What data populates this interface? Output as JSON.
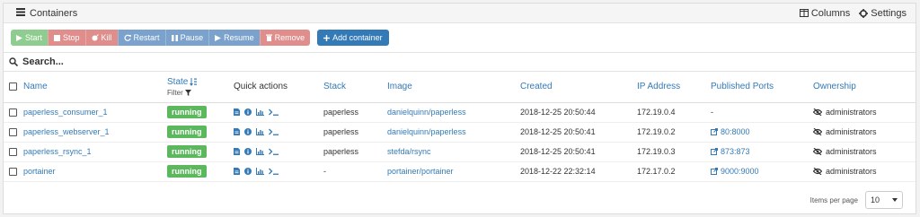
{
  "header": {
    "title": "Containers",
    "columns_label": "Columns",
    "settings_label": "Settings"
  },
  "toolbar": {
    "start": "Start",
    "stop": "Stop",
    "kill": "Kill",
    "restart": "Restart",
    "pause": "Pause",
    "resume": "Resume",
    "remove": "Remove",
    "add": "Add container"
  },
  "search": {
    "placeholder": "Search..."
  },
  "table": {
    "headers": {
      "name": "Name",
      "state": "State",
      "filter": "Filter",
      "quick_actions": "Quick actions",
      "stack": "Stack",
      "image": "Image",
      "created": "Created",
      "ip": "IP Address",
      "ports": "Published Ports",
      "ownership": "Ownership"
    },
    "rows": [
      {
        "name": "paperless_consumer_1",
        "state": "running",
        "stack": "paperless",
        "image": "danielquinn/paperless",
        "created": "2018-12-25 20:50:44",
        "ip": "172.19.0.4",
        "ports": "-",
        "ownership": "administrators"
      },
      {
        "name": "paperless_webserver_1",
        "state": "running",
        "stack": "paperless",
        "image": "danielquinn/paperless",
        "created": "2018-12-25 20:50:41",
        "ip": "172.19.0.2",
        "ports": "80:8000",
        "ownership": "administrators"
      },
      {
        "name": "paperless_rsync_1",
        "state": "running",
        "stack": "paperless",
        "image": "stefda/rsync",
        "created": "2018-12-25 20:50:41",
        "ip": "172.19.0.3",
        "ports": "873:873",
        "ownership": "administrators"
      },
      {
        "name": "portainer",
        "state": "running",
        "stack": "-",
        "image": "portainer/portainer",
        "created": "2018-12-22 22:32:14",
        "ip": "172.17.0.2",
        "ports": "9000:9000",
        "ownership": "administrators"
      }
    ]
  },
  "footer": {
    "items_per_page_label": "Items per page",
    "items_per_page_value": "10"
  }
}
